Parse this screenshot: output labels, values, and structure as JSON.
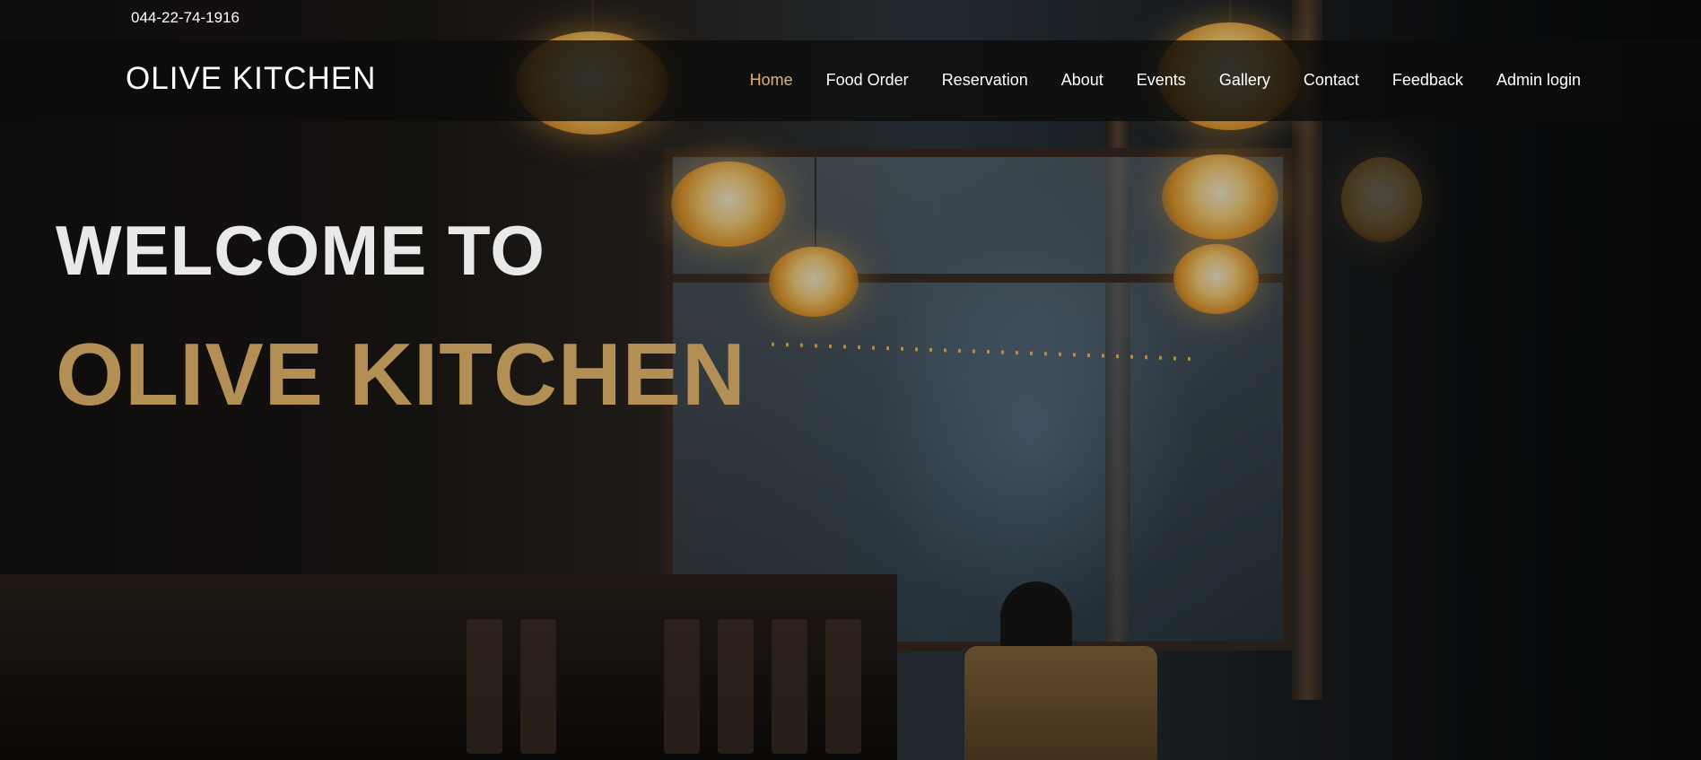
{
  "topbar": {
    "phone": "044-22-74-1916"
  },
  "navbar": {
    "brand": "OLIVE KITCHEN",
    "items": [
      {
        "label": "Home",
        "active": true
      },
      {
        "label": "Food Order",
        "active": false
      },
      {
        "label": "Reservation",
        "active": false
      },
      {
        "label": "About",
        "active": false
      },
      {
        "label": "Events",
        "active": false
      },
      {
        "label": "Gallery",
        "active": false
      },
      {
        "label": "Contact",
        "active": false
      },
      {
        "label": "Feedback",
        "active": false
      },
      {
        "label": "Admin login",
        "active": false
      }
    ]
  },
  "hero": {
    "welcome": "WELCOME TO",
    "title": "OLIVE KITCHEN"
  },
  "colors": {
    "accent": "#b38f55",
    "nav_active": "#d8b37a",
    "navbar_bg": "#0c0b0a"
  }
}
